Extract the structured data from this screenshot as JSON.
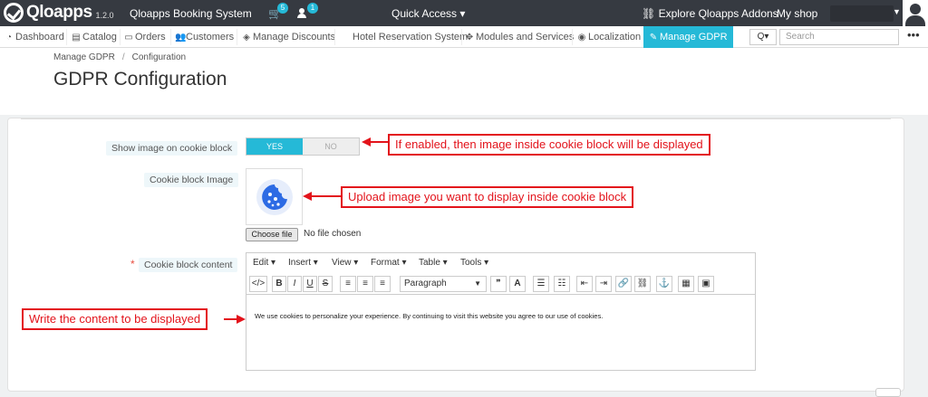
{
  "topbar": {
    "brand": "Qloapps",
    "version": "1.2.0",
    "shop_name": "Qloapps Booking System",
    "cart_count": "5",
    "user_count": "1",
    "quick_access": "Quick Access ▾",
    "explore": "Explore Qloapps Addons",
    "my_shop": "My shop"
  },
  "nav": {
    "items": [
      {
        "label": "Dashboard",
        "icon": "◔"
      },
      {
        "label": "Catalog",
        "icon": "▤"
      },
      {
        "label": "Orders",
        "icon": "▭"
      },
      {
        "label": "Customers",
        "icon": "👥"
      },
      {
        "label": "Manage Discounts",
        "icon": "◈"
      },
      {
        "label": "Hotel Reservation System",
        "icon": ""
      },
      {
        "label": "Modules and Services",
        "icon": "✥"
      },
      {
        "label": "Localization",
        "icon": "◉"
      },
      {
        "label": "Manage GDPR",
        "icon": "✎"
      }
    ],
    "search_placeholder": "Search",
    "search_icon": "Q▾",
    "more": "•••"
  },
  "breadcrumb": {
    "parent": "Manage GDPR",
    "separator": "/",
    "current": "Configuration"
  },
  "page_title": "GDPR Configuration",
  "form": {
    "show_image_label": "Show image on cookie block",
    "toggle_yes": "YES",
    "toggle_no": "NO",
    "image_label": "Cookie block Image",
    "choose_file": "Choose file",
    "no_file": "No file chosen",
    "required_mark": "*",
    "content_label": "Cookie block content"
  },
  "editor": {
    "menus": [
      "Edit ▾",
      "Insert ▾",
      "View ▾",
      "Format ▾",
      "Table ▾",
      "Tools ▾"
    ],
    "tools": [
      "</>",
      "B",
      "I",
      "U",
      "S",
      "≡",
      "≡",
      "≡",
      "Paragraph",
      "❞",
      "A",
      "☰",
      "☷",
      "⇤",
      "⇥",
      "🔗",
      "⛓",
      "⚓",
      "▦",
      "▣"
    ],
    "content": "We use cookies to personalize your experience. By continuing to visit this website you agree to our use of cookies."
  },
  "callouts": {
    "toggle_note": "If enabled, then image inside cookie block will be displayed",
    "image_note": "Upload image you want to display inside cookie block",
    "content_note": "Write the content to be displayed"
  },
  "colors": {
    "accent": "#25b9d7",
    "callout": "#e3131b",
    "topbar": "#363a41"
  }
}
